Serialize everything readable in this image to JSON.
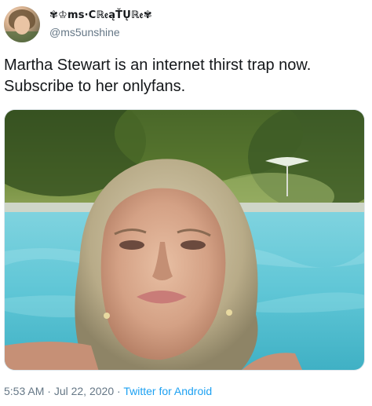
{
  "tweet": {
    "author": {
      "display_name": "✾♔ms·Cℝ𝔢ąŤŲℝ𝔢✾",
      "handle": "@ms5unshine",
      "avatar_icon": "avatar-photo"
    },
    "text": "Martha Stewart is an internet thirst trap now. Subscribe to her onlyfans.",
    "media": {
      "type": "photo",
      "icon": "selfie-by-pool-photo"
    },
    "footer": {
      "time": "5:53 AM",
      "separator1": " · ",
      "date": "Jul 22, 2020",
      "separator2": " · ",
      "source": "Twitter for Android"
    },
    "colors": {
      "text": "#14171a",
      "secondary": "#657786",
      "link": "#1da1f2"
    }
  }
}
